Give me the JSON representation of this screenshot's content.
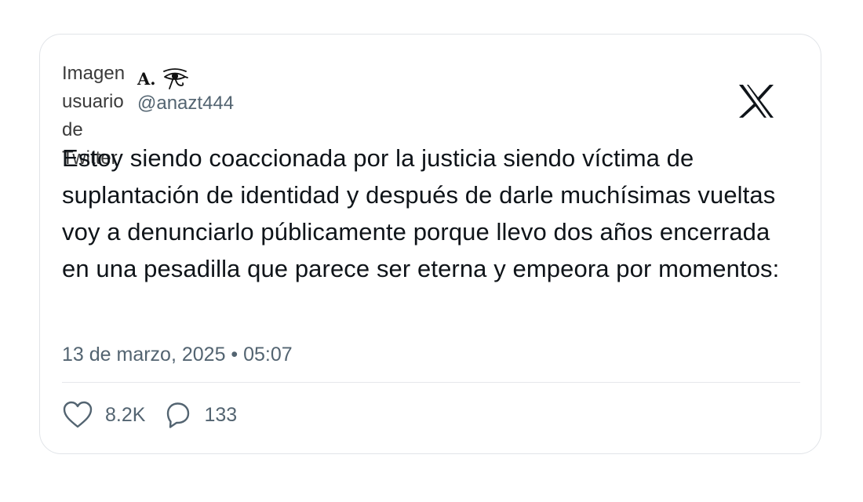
{
  "tweet": {
    "avatar_alt_words": [
      "Imagen",
      "usuario",
      "de",
      "Twitter"
    ],
    "display_name": "A.",
    "handle": "@anazt444",
    "text": "Estoy siendo coaccionada por la justicia siendo víctima de suplantación de identidad y después de darle muchísimas vueltas voy a denunciarlo públicamente porque llevo dos años encerrada en una pesadilla que parece ser eterna y empeora por momentos:",
    "timestamp": "13 de marzo, 2025 • 05:07",
    "likes": "8.2K",
    "replies": "133"
  },
  "icons": {
    "brand": "x-logo-icon",
    "emoji": "eye-of-horus-icon",
    "like": "heart-icon",
    "reply": "comment-bubble-icon"
  },
  "colors": {
    "text": "#0f1419",
    "secondary": "#536471",
    "border": "#e1e4e8"
  }
}
